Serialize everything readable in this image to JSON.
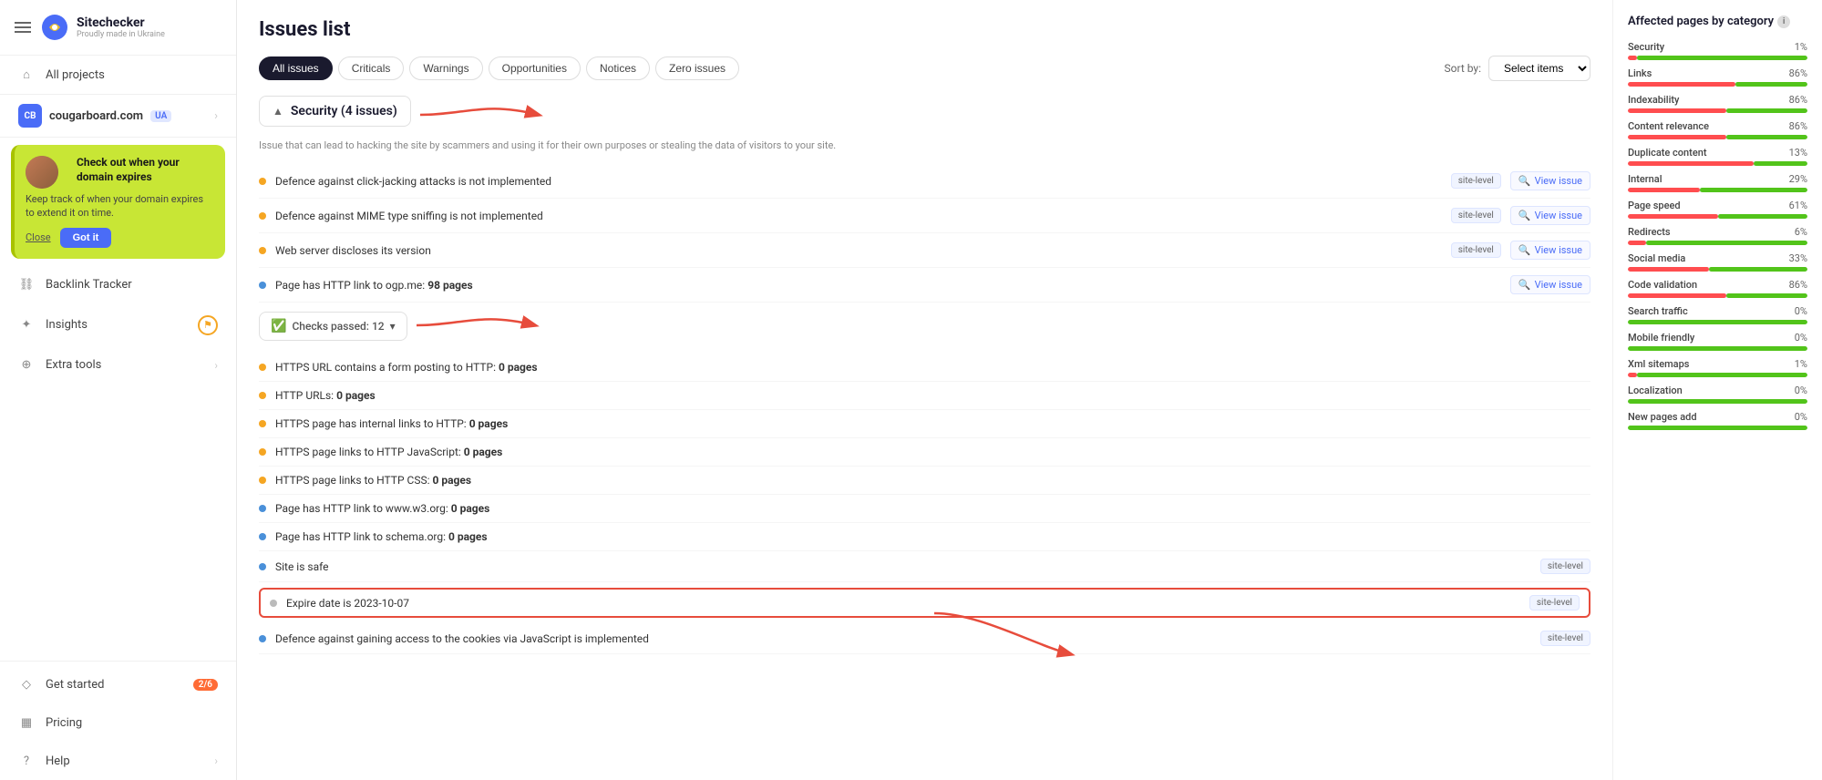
{
  "app": {
    "name": "Sitechecker",
    "tagline": "Proudly made in Ukraine"
  },
  "sidebar": {
    "hamburger_label": "menu",
    "all_projects_label": "All projects",
    "domain": {
      "name": "cougarboard.com",
      "badge": "UA",
      "icon": "CB"
    },
    "notification": {
      "title": "Check out when your domain expires",
      "desc": "Keep track of when your domain expires to extend it on time.",
      "close_label": "Close",
      "btn_label": "Got it"
    },
    "items": [
      {
        "id": "backlink-tracker",
        "label": "Backlink Tracker",
        "icon": "link"
      },
      {
        "id": "insights",
        "label": "Insights",
        "icon": "sparkle",
        "badge": ""
      },
      {
        "id": "extra-tools",
        "label": "Extra tools",
        "icon": "plus",
        "arrow": true
      },
      {
        "id": "get-started",
        "label": "Get started",
        "icon": "diamond",
        "badge": "2/6"
      },
      {
        "id": "pricing",
        "label": "Pricing",
        "icon": "grid"
      },
      {
        "id": "help",
        "label": "Help",
        "icon": "question",
        "arrow": true
      }
    ]
  },
  "page": {
    "title": "Issues list"
  },
  "tabs": [
    {
      "id": "all-issues",
      "label": "All issues",
      "active": true
    },
    {
      "id": "criticals",
      "label": "Criticals",
      "active": false
    },
    {
      "id": "warnings",
      "label": "Warnings",
      "active": false
    },
    {
      "id": "opportunities",
      "label": "Opportunities",
      "active": false
    },
    {
      "id": "notices",
      "label": "Notices",
      "active": false
    },
    {
      "id": "zero-issues",
      "label": "Zero issues",
      "active": false
    }
  ],
  "sort": {
    "label": "Sort by:",
    "placeholder": "Select items"
  },
  "security_section": {
    "title": "Security (4 issues)",
    "desc": "Issue that can lead to hacking the site by scammers and using it for their own purposes or stealing the data of visitors to your site.",
    "issues": [
      {
        "id": "clickjacking",
        "text": "Defence against click-jacking attacks is not implemented",
        "badge": "site-level",
        "dot": "orange",
        "view": true
      },
      {
        "id": "mime-sniffing",
        "text": "Defence against MIME type sniffing is not implemented",
        "badge": "site-level",
        "dot": "orange",
        "view": true
      },
      {
        "id": "web-server",
        "text": "Web server discloses its version",
        "badge": "site-level",
        "dot": "orange",
        "view": true
      },
      {
        "id": "http-link-ogp",
        "text": "Page has HTTP link to ogp.me:",
        "pages": "98 pages",
        "dot": "blue",
        "view": true
      }
    ]
  },
  "checks_passed": {
    "label": "Checks passed: 12",
    "count": 12,
    "items": [
      {
        "id": "https-form",
        "text": "HTTPS URL contains a form posting to HTTP:",
        "pages": "0 pages",
        "dot": "orange"
      },
      {
        "id": "http-urls",
        "text": "HTTP URLs:",
        "pages": "0 pages",
        "dot": "orange"
      },
      {
        "id": "https-internal",
        "text": "HTTPS page has internal links to HTTP:",
        "pages": "0 pages",
        "dot": "orange"
      },
      {
        "id": "https-js",
        "text": "HTTPS page links to HTTP JavaScript:",
        "pages": "0 pages",
        "dot": "orange"
      },
      {
        "id": "https-css",
        "text": "HTTPS page links to HTTP CSS:",
        "pages": "0 pages",
        "dot": "orange"
      },
      {
        "id": "http-w3",
        "text": "Page has HTTP link to www.w3.org:",
        "pages": "0 pages",
        "dot": "blue"
      },
      {
        "id": "http-schema",
        "text": "Page has HTTP link to schema.org:",
        "pages": "0 pages",
        "dot": "blue"
      },
      {
        "id": "site-safe",
        "text": "Site is safe",
        "badge": "site-level",
        "dot": "blue"
      },
      {
        "id": "expire-date",
        "text": "Expire date is 2023-10-07",
        "badge": "site-level",
        "dot": "gray",
        "highlighted": true
      },
      {
        "id": "cookie-defence",
        "text": "Defence against gaining access to the cookies via JavaScript is implemented",
        "badge": "site-level",
        "dot": "blue"
      }
    ]
  },
  "right_panel": {
    "title": "Affected pages by category",
    "categories": [
      {
        "name": "Security",
        "pct": 1,
        "red_pct": 5,
        "green_pct": 95
      },
      {
        "name": "Links",
        "pct": 86,
        "red_pct": 60,
        "green_pct": 40
      },
      {
        "name": "Indexability",
        "pct": 86,
        "red_pct": 55,
        "green_pct": 45
      },
      {
        "name": "Content relevance",
        "pct": 86,
        "red_pct": 55,
        "green_pct": 45
      },
      {
        "name": "Duplicate content",
        "pct": 13,
        "red_pct": 70,
        "green_pct": 30
      },
      {
        "name": "Internal",
        "pct": 29,
        "red_pct": 40,
        "green_pct": 60
      },
      {
        "name": "Page speed",
        "pct": 61,
        "red_pct": 50,
        "green_pct": 50
      },
      {
        "name": "Redirects",
        "pct": 6,
        "red_pct": 10,
        "green_pct": 90
      },
      {
        "name": "Social media",
        "pct": 33,
        "red_pct": 45,
        "green_pct": 55
      },
      {
        "name": "Code validation",
        "pct": 86,
        "red_pct": 55,
        "green_pct": 45
      },
      {
        "name": "Search traffic",
        "pct": 0,
        "red_pct": 0,
        "green_pct": 100
      },
      {
        "name": "Mobile friendly",
        "pct": 0,
        "red_pct": 0,
        "green_pct": 100
      },
      {
        "name": "Xml sitemaps",
        "pct": 1,
        "red_pct": 5,
        "green_pct": 95
      },
      {
        "name": "Localization",
        "pct": 0,
        "red_pct": 0,
        "green_pct": 100
      },
      {
        "name": "New pages add",
        "pct": 0,
        "red_pct": 0,
        "green_pct": 100
      }
    ]
  },
  "view_issue_label": "View issue",
  "checks_passed_label": "Checks passed: 12"
}
